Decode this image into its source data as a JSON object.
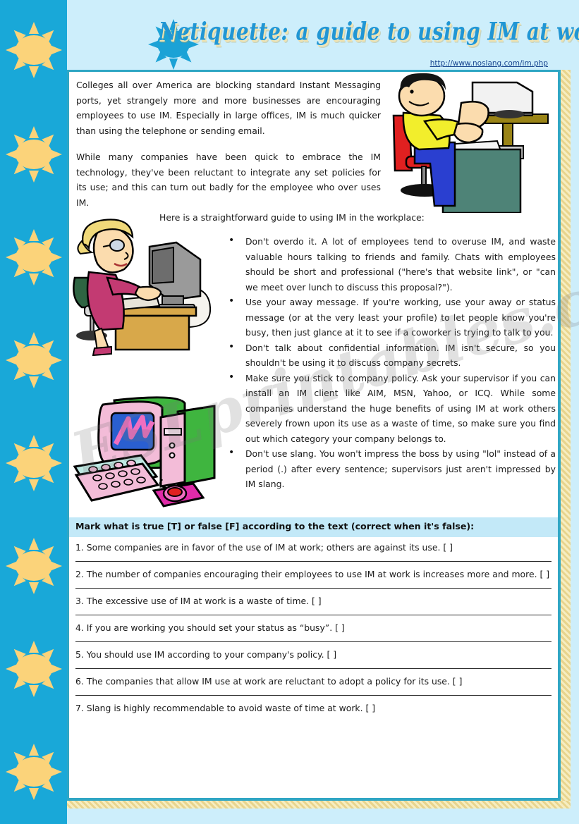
{
  "header": {
    "title": "Netiquette: a guide to using IM at work.",
    "source_url": "http://www.noslang.com/im.php",
    "sun_icon": "sun-icon"
  },
  "watermark": "ESLprintables.com",
  "article": {
    "paragraphs": [
      "Colleges all over America are blocking standard Instant Messaging ports, yet strangely more and more businesses are encouraging employees to use IM. Especially in large offices, IM is much quicker than using the telephone or sending email.",
      "While many companies have been quick to embrace the IM technology, they've been reluctant to integrate any set policies for its use; and this can turn out badly for the employee who over uses IM."
    ],
    "intro": "Here is a straightforward guide to using IM in the workplace:",
    "bullets": [
      "Don't overdo it. A lot of employees tend to overuse IM, and waste valuable hours talking to friends and family. Chats with employees should be short and professional (\"here's that website link\", or \"can we meet over lunch to discuss this proposal?\").",
      "Use your away message. If you're working, use your away or status message (or at the very least your profile) to let people know you're busy, then just glance at it to see if a coworker is trying to talk to you.",
      "Don't talk about confidential information. IM isn't secure, so you shouldn't be using it to discuss company secrets.",
      "Make sure you stick to company policy. Ask your supervisor if you can install an IM client like AIM, MSN, Yahoo, or ICQ. While some companies understand the huge benefits of using IM at work others severely frown upon its use as a waste of time, so make sure you find out which category your company belongs to.",
      "Don't use slang. You won't impress the boss by using \"lol\" instead of a period (.) after every sentence; supervisors just aren't impressed by IM slang."
    ],
    "images": [
      "man-at-computer-clipart",
      "woman-at-computer-clipart",
      "desktop-computer-clipart"
    ]
  },
  "exercise": {
    "instruction": "Mark what is true [T] or false [F] according to the text (correct when it's false):",
    "questions": [
      "1. Some companies are in favor of the use of IM at work; others are against its use. [   ]",
      "2. The number of companies encouraging their employees to use IM at work is increases more and more. [   ]",
      "3. The excessive use of IM at work is a waste of time. [   ]",
      "4. If you are working you should set your status as “busy”. [   ]",
      "5. You should use IM according to your company's policy. [   ]",
      "6. The companies that allow IM use at work are reluctant to adopt a policy for its use. [   ]",
      "7. Slang is highly recommendable to avoid waste of time at work. [   ]"
    ]
  },
  "colors": {
    "sidebar_bg": "#19a8d8",
    "sun_yellow": "#fbd37a",
    "page_bg": "#cdeefb",
    "band_bg": "#c3e9f8",
    "sheet_border": "#2fa6c4",
    "title_blue": "#2196d4"
  }
}
